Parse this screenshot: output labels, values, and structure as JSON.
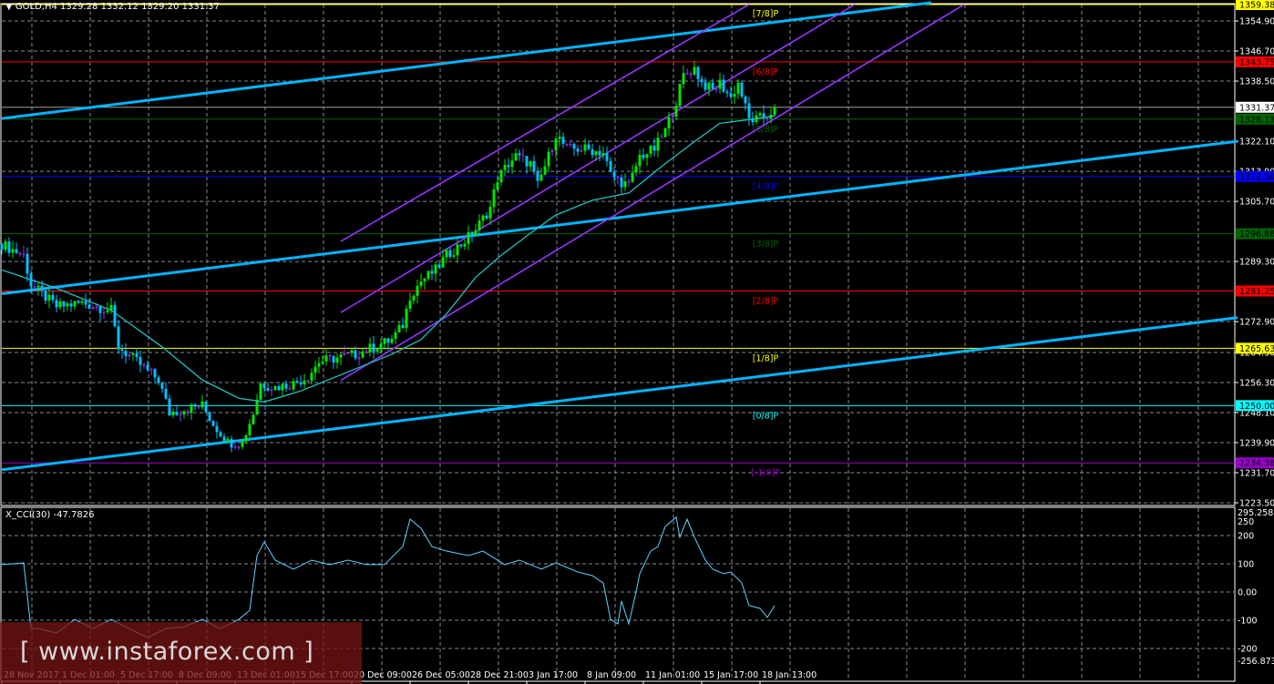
{
  "header": {
    "symbol": "GOLD,H4",
    "ohlc": "1329.28 1332.12 1329.20 1331.37"
  },
  "indicator": {
    "label": "X_CCI(30) -47.7826"
  },
  "watermark": "[ www.instaforex.com ]",
  "colors": {
    "up": "#00e600",
    "down": "#00bfff",
    "ma": "#20c0c0",
    "trend": "#00b4ff",
    "channel": "#9933ff",
    "cci": "#5fd3ff",
    "grid": "#7f8a99"
  },
  "chart_data": [
    {
      "type": "candlestick",
      "title": "GOLD,H4",
      "timeframe": "H4",
      "x_unit": "bar index (H4 bars from 28 Nov 2017)",
      "x_ticks": [
        {
          "bar": 0,
          "label": "28 Nov 2017"
        },
        {
          "bar": 16,
          "label": "1 Dec 01:00"
        },
        {
          "bar": 32,
          "label": "5 Dec 17:00"
        },
        {
          "bar": 48,
          "label": "8 Dec 09:00"
        },
        {
          "bar": 64,
          "label": "13 Dec 01:00"
        },
        {
          "bar": 80,
          "label": "15 Dec 17:00"
        },
        {
          "bar": 96,
          "label": "20 Dec 09:00"
        },
        {
          "bar": 112,
          "label": "26 Dec 05:00"
        },
        {
          "bar": 128,
          "label": "28 Dec 21:00"
        },
        {
          "bar": 144,
          "label": "3 Jan 17:00"
        },
        {
          "bar": 160,
          "label": "8 Jan 09:00"
        },
        {
          "bar": 176,
          "label": "11 Jan 01:00"
        },
        {
          "bar": 192,
          "label": "15 Jan 17:00"
        },
        {
          "bar": 208,
          "label": "18 Jan 13:00"
        }
      ],
      "ylim": [
        1223.5,
        1359.38
      ],
      "y_ticks": [
        "1354.90",
        "1346.70",
        "1338.50",
        "1322.10",
        "1313.90",
        "1305.70",
        "1289.30",
        "1272.90",
        "1264.50",
        "1256.30",
        "1248.10",
        "1239.90",
        "1231.70",
        "1223.50"
      ],
      "close_path": [
        [
          0,
          1294
        ],
        [
          6,
          1291
        ],
        [
          8,
          1283
        ],
        [
          15,
          1277
        ],
        [
          22,
          1278
        ],
        [
          30,
          1276
        ],
        [
          32,
          1266
        ],
        [
          37,
          1262
        ],
        [
          43,
          1257
        ],
        [
          46,
          1248
        ],
        [
          50,
          1249
        ],
        [
          55,
          1250
        ],
        [
          58,
          1245
        ],
        [
          62,
          1240
        ],
        [
          66,
          1240
        ],
        [
          69,
          1248
        ],
        [
          71,
          1256
        ],
        [
          75,
          1255
        ],
        [
          80,
          1256
        ],
        [
          84,
          1258
        ],
        [
          87,
          1262
        ],
        [
          92,
          1263
        ],
        [
          97,
          1264
        ],
        [
          102,
          1266
        ],
        [
          107,
          1268
        ],
        [
          110,
          1272
        ],
        [
          112,
          1280
        ],
        [
          115,
          1284
        ],
        [
          119,
          1287
        ],
        [
          122,
          1291
        ],
        [
          126,
          1294
        ],
        [
          130,
          1298
        ],
        [
          134,
          1304
        ],
        [
          136,
          1312
        ],
        [
          139,
          1316
        ],
        [
          141,
          1318
        ],
        [
          145,
          1316
        ],
        [
          147,
          1310
        ],
        [
          150,
          1318
        ],
        [
          152,
          1324
        ],
        [
          155,
          1320
        ],
        [
          160,
          1320
        ],
        [
          165,
          1319
        ],
        [
          167,
          1313
        ],
        [
          170,
          1311
        ],
        [
          172,
          1310
        ],
        [
          175,
          1318
        ],
        [
          179,
          1320
        ],
        [
          182,
          1325
        ],
        [
          185,
          1333
        ],
        [
          187,
          1340
        ],
        [
          190,
          1342
        ],
        [
          192,
          1338
        ],
        [
          195,
          1336
        ],
        [
          197,
          1338
        ],
        [
          200,
          1334
        ],
        [
          202,
          1338
        ],
        [
          205,
          1328
        ],
        [
          207,
          1328
        ],
        [
          210,
          1329
        ],
        [
          212,
          1331.37
        ]
      ],
      "moving_average": [
        [
          0,
          1287
        ],
        [
          15,
          1282
        ],
        [
          30,
          1276
        ],
        [
          44,
          1266
        ],
        [
          55,
          1257
        ],
        [
          65,
          1252
        ],
        [
          72,
          1251
        ],
        [
          82,
          1254
        ],
        [
          97,
          1260
        ],
        [
          107,
          1264
        ],
        [
          115,
          1268
        ],
        [
          122,
          1275
        ],
        [
          130,
          1285
        ],
        [
          137,
          1291
        ],
        [
          145,
          1297
        ],
        [
          152,
          1302
        ],
        [
          162,
          1306
        ],
        [
          172,
          1308
        ],
        [
          182,
          1316
        ],
        [
          190,
          1322
        ],
        [
          197,
          1327
        ],
        [
          205,
          1328
        ],
        [
          212,
          1329
        ]
      ],
      "current_price": {
        "value": 1331.37,
        "label": "1331.37"
      },
      "murrey_levels": [
        {
          "label": "[7/8]P",
          "value": 1359.38,
          "text": "1359.38",
          "color": "#ffff00",
          "text_color": "#000000"
        },
        {
          "label": "[6/8]P",
          "value": 1343.75,
          "text": "1343.75",
          "color": "#ff0000",
          "text_color": "#000000"
        },
        {
          "label": "[5/8]P",
          "value": 1328.13,
          "text": "1328.13",
          "color": "#006400",
          "text_color": "#000000"
        },
        {
          "label": "[4/8]P",
          "value": 1312.5,
          "text": "1312.50",
          "color": "#0000ff",
          "text_color": "#000000"
        },
        {
          "label": "[3/8]P",
          "value": 1296.88,
          "text": "1296.88",
          "color": "#006400",
          "text_color": "#000000"
        },
        {
          "label": "[2/8]P",
          "value": 1281.25,
          "text": "1281.25",
          "color": "#ff0000",
          "text_color": "#000000"
        },
        {
          "label": "[1/8]P",
          "value": 1265.63,
          "text": "1265.63",
          "color": "#ffff00",
          "text_color": "#000000"
        },
        {
          "label": "[0/8]P",
          "value": 1250.0,
          "text": "1250.00",
          "color": "#00ffff",
          "text_color": "#000000"
        },
        {
          "label": "[-1/8]P",
          "value": 1234.38,
          "text": "1234.38",
          "color": "#9900cc",
          "text_color": "#000000"
        }
      ],
      "trendlines": [
        {
          "name": "trendline-upper",
          "points": [
            [
              0,
              1328.3
            ],
            [
              255,
              1359.9
            ]
          ]
        },
        {
          "name": "trendline-middle",
          "points": [
            [
              0,
              1280.5
            ],
            [
              339,
              1322.1
            ]
          ]
        },
        {
          "name": "trendline-lower",
          "points": [
            [
              0,
              1232.5
            ],
            [
              339,
              1274.0
            ]
          ]
        }
      ],
      "channel": [
        {
          "name": "channel-upper",
          "points": [
            [
              93,
              1294.8
            ],
            [
              205,
              1359.4
            ]
          ]
        },
        {
          "name": "channel-middle",
          "points": [
            [
              93,
              1275.4
            ],
            [
              234,
              1359.4
            ]
          ]
        },
        {
          "name": "channel-lower",
          "points": [
            [
              93,
              1256.9
            ],
            [
              264,
              1359.4
            ]
          ]
        }
      ]
    },
    {
      "type": "line",
      "title": "X_CCI(30)",
      "current": -47.7826,
      "ylim": [
        -256.8731,
        295.2588
      ],
      "y_ticks": [
        "295.2588",
        "250",
        "200",
        "100",
        "0.00",
        "-100",
        "-200",
        "-256.8731"
      ],
      "values": [
        [
          0,
          97
        ],
        [
          6,
          103
        ],
        [
          8,
          -130
        ],
        [
          10,
          -130
        ],
        [
          15,
          -145
        ],
        [
          20,
          -97
        ],
        [
          25,
          -130
        ],
        [
          30,
          -97
        ],
        [
          35,
          -130
        ],
        [
          40,
          -161
        ],
        [
          45,
          -130
        ],
        [
          50,
          -123
        ],
        [
          55,
          -97
        ],
        [
          60,
          -130
        ],
        [
          65,
          -97
        ],
        [
          68,
          -65
        ],
        [
          70,
          129
        ],
        [
          72,
          177
        ],
        [
          75,
          113
        ],
        [
          80,
          81
        ],
        [
          85,
          113
        ],
        [
          90,
          97
        ],
        [
          95,
          113
        ],
        [
          100,
          97
        ],
        [
          105,
          97
        ],
        [
          110,
          161
        ],
        [
          112,
          258
        ],
        [
          115,
          226
        ],
        [
          118,
          161
        ],
        [
          122,
          145
        ],
        [
          128,
          129
        ],
        [
          132,
          145
        ],
        [
          138,
          97
        ],
        [
          142,
          113
        ],
        [
          148,
          81
        ],
        [
          152,
          103
        ],
        [
          158,
          71
        ],
        [
          162,
          58
        ],
        [
          165,
          32
        ],
        [
          167,
          -97
        ],
        [
          169,
          -113
        ],
        [
          170,
          -32
        ],
        [
          172,
          -113
        ],
        [
          174,
          0
        ],
        [
          175,
          65
        ],
        [
          178,
          145
        ],
        [
          180,
          161
        ],
        [
          182,
          232
        ],
        [
          185,
          265
        ],
        [
          186,
          194
        ],
        [
          188,
          258
        ],
        [
          190,
          194
        ],
        [
          193,
          113
        ],
        [
          195,
          81
        ],
        [
          198,
          65
        ],
        [
          200,
          71
        ],
        [
          203,
          32
        ],
        [
          205,
          -48
        ],
        [
          208,
          -58
        ],
        [
          210,
          -90
        ],
        [
          212,
          -48
        ]
      ]
    }
  ]
}
